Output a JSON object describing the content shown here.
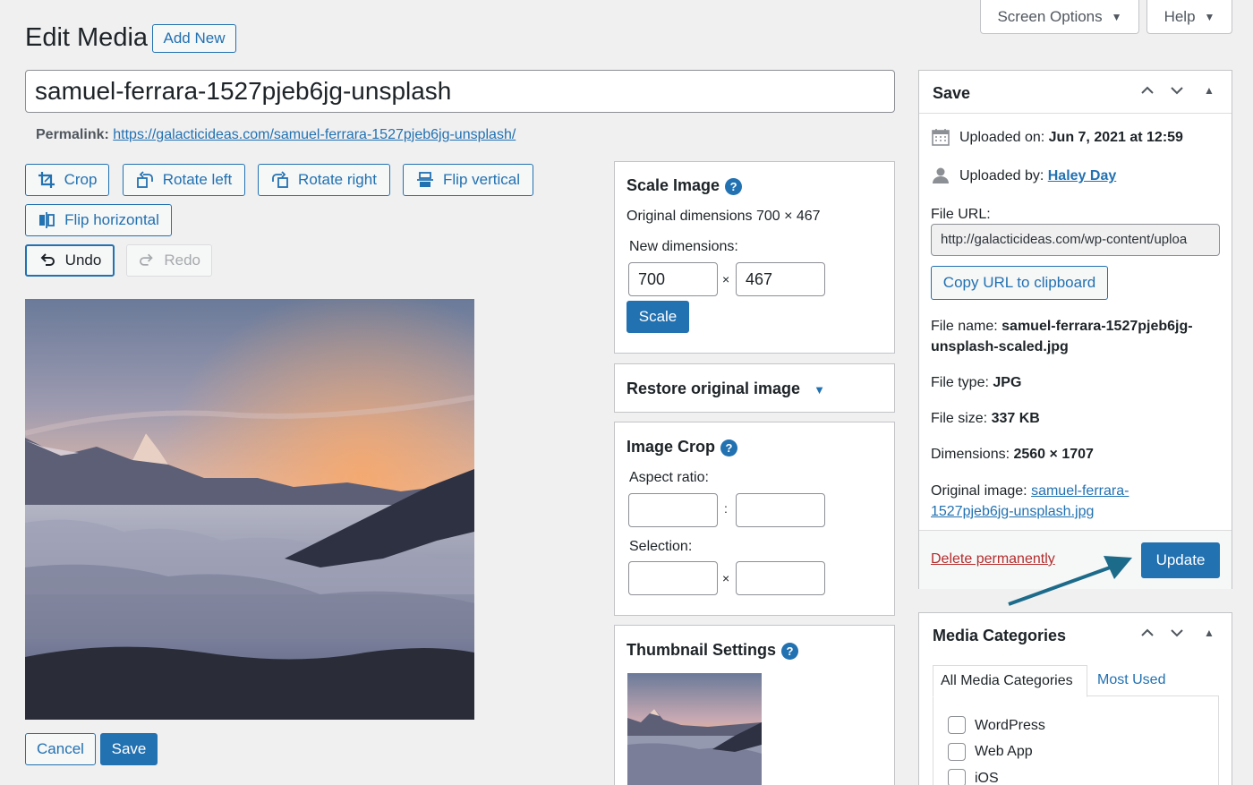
{
  "screen_meta": {
    "screen_options": "Screen Options",
    "help": "Help"
  },
  "header": {
    "title": "Edit Media",
    "add_new": "Add New"
  },
  "post_title": "samuel-ferrara-1527pjeb6jg-unsplash",
  "permalink": {
    "label": "Permalink:",
    "url": "https://galacticideas.com/samuel-ferrara-1527pjeb6jg-unsplash/"
  },
  "editor_toolbar": {
    "crop": "Crop",
    "rotate_left": "Rotate left",
    "rotate_right": "Rotate right",
    "flip_vertical": "Flip vertical",
    "flip_horizontal": "Flip horizontal",
    "undo": "Undo",
    "redo": "Redo"
  },
  "editor_actions": {
    "cancel": "Cancel",
    "save": "Save"
  },
  "scale_image": {
    "title": "Scale Image",
    "original": "Original dimensions 700 × 467",
    "new_dimensions": "New dimensions:",
    "width": "700",
    "height": "467",
    "times": "×",
    "scale_button": "Scale"
  },
  "restore": {
    "title": "Restore original image"
  },
  "image_crop": {
    "title": "Image Crop",
    "aspect_ratio": "Aspect ratio:",
    "colon": ":",
    "selection": "Selection:",
    "times": "×"
  },
  "thumbnail": {
    "title": "Thumbnail Settings"
  },
  "save_box": {
    "title": "Save",
    "uploaded_on_label": "Uploaded on:",
    "uploaded_on_value": "Jun 7, 2021 at 12:59",
    "uploaded_by_label": "Uploaded by:",
    "uploaded_by_value": "Haley Day",
    "file_url_label": "File URL:",
    "file_url_value": "http://galacticideas.com/wp-content/uploa",
    "copy_url": "Copy URL to clipboard",
    "file_name_label": "File name:",
    "file_name_value_1": "samuel-ferrara-1527pjeb6jg-",
    "file_name_value_2": "unsplash-scaled.jpg",
    "file_type_label": "File type:",
    "file_type_value": "JPG",
    "file_size_label": "File size:",
    "file_size_value": "337 KB",
    "dimensions_label": "Dimensions:",
    "dimensions_value": "2560 × 1707",
    "original_label": "Original image:",
    "original_value_1": "samuel-ferrara-",
    "original_value_2": "1527pjeb6jg-unsplash.jpg",
    "delete": "Delete permanently",
    "update": "Update"
  },
  "media_categories": {
    "title": "Media Categories",
    "tab_all": "All Media Categories",
    "tab_most_used": "Most Used",
    "items": [
      "WordPress",
      "Web App",
      "iOS"
    ]
  },
  "colors": {
    "accent": "#2271b1",
    "danger": "#b32d2e",
    "arrow": "#1d6b8a"
  }
}
